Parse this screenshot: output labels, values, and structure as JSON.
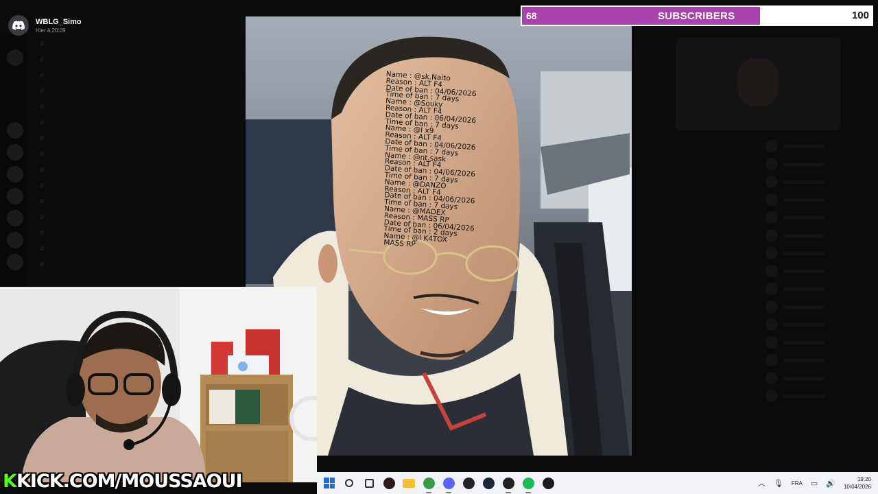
{
  "notification": {
    "username": "WBLG_Simo",
    "time": "Hier à 20:09"
  },
  "sub_goal": {
    "current": "68",
    "label": "SUBSCRIBERS",
    "target": "100",
    "progress": 0.68,
    "fill_color": "#a843ab"
  },
  "meme": {
    "forehead_lines": [
      "Name : @sk.Naito",
      "Reason : ALT F4",
      "Date of ban : 04/06/2026",
      "Time of ban : 7 days",
      "Name : @Souky",
      "Reason : ALT F4",
      "Date of ban : 06/04/2026",
      "Time of ban : 7 days",
      "Name : @l x9",
      "Reason : ALT F4",
      "Date of ban : 04/06/2026",
      "Time of ban : 7 days",
      "Name : @nt.sask",
      "Reason : ALT F4",
      "Date of ban : 04/06/2026",
      "Time of ban : 7 days",
      "Name : @DANZO",
      "Reason : ALT F4",
      "Date of ban : 04/06/2026",
      "Time of ban : 7 days",
      "Name : @MADEX",
      "Reason : MASS RP",
      "Date of ban : 06/04/2026",
      "Time of ban : 2 days",
      "Name : @l K4TOX",
      "MASS RP"
    ]
  },
  "watermark": {
    "k": "K",
    "rest": "KICK.COM/MOUSSAOUI"
  },
  "taskbar": {
    "apps": [
      {
        "name": "windows-start-icon",
        "color": "#1f6fd1"
      },
      {
        "name": "search-icon",
        "color": "#333333"
      },
      {
        "name": "task-view-icon",
        "color": "#333333"
      },
      {
        "name": "obs-icon",
        "color": "#2b1b1b"
      },
      {
        "name": "file-explorer-icon",
        "color": "#f3c03b"
      },
      {
        "name": "chrome-icon",
        "color": "#3b9a4a"
      },
      {
        "name": "discord-icon",
        "color": "#5865f2"
      },
      {
        "name": "github-icon",
        "color": "#222222"
      },
      {
        "name": "steam-icon",
        "color": "#1b2838"
      },
      {
        "name": "obs-recording-icon",
        "color": "#222222"
      },
      {
        "name": "spotify-icon",
        "color": "#1db954"
      },
      {
        "name": "terminal-icon",
        "color": "#1c1c1c"
      }
    ],
    "language": "FRA",
    "time": "19:20",
    "date": "10/04/2026"
  }
}
